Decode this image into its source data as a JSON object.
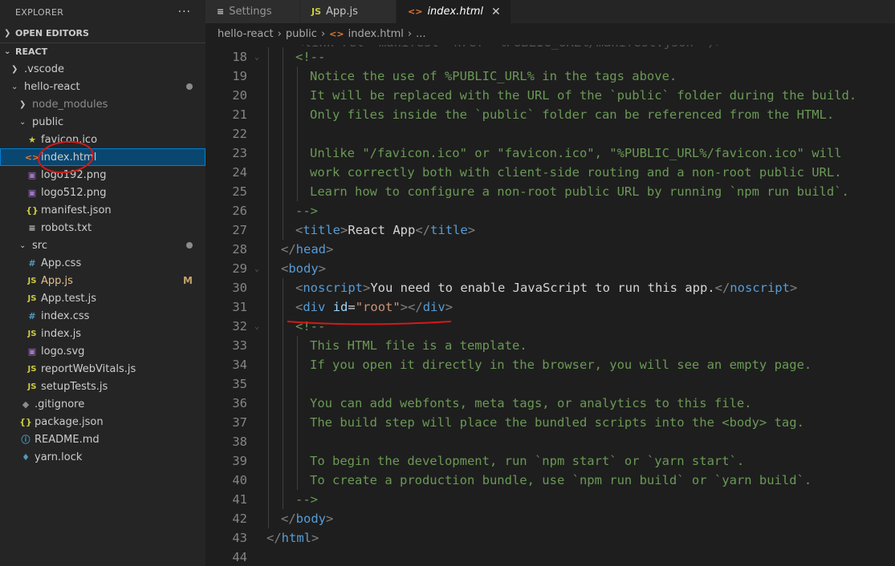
{
  "sidebar": {
    "title": "EXPLORER",
    "more": "···",
    "open_editors": "OPEN EDITORS",
    "workspace": "REACT",
    "tree": [
      {
        "label": ".vscode",
        "indent": 1,
        "kind": "folder-closed"
      },
      {
        "label": "hello-react",
        "indent": 1,
        "kind": "folder-open",
        "badge": "dot"
      },
      {
        "label": "node_modules",
        "indent": 2,
        "kind": "folder-closed",
        "dim": true
      },
      {
        "label": "public",
        "indent": 2,
        "kind": "folder-open"
      },
      {
        "label": "favicon.ico",
        "indent": 3,
        "icon": "star-icon",
        "glyph": "★",
        "cls": "ic-star"
      },
      {
        "label": "index.html",
        "indent": 3,
        "icon": "html-icon",
        "glyph": "<>",
        "cls": "ic-html",
        "selected": true
      },
      {
        "label": "logo192.png",
        "indent": 3,
        "icon": "image-icon",
        "glyph": "▣",
        "cls": "ic-img"
      },
      {
        "label": "logo512.png",
        "indent": 3,
        "icon": "image-icon",
        "glyph": "▣",
        "cls": "ic-img"
      },
      {
        "label": "manifest.json",
        "indent": 3,
        "icon": "json-icon",
        "glyph": "{}",
        "cls": "ic-json"
      },
      {
        "label": "robots.txt",
        "indent": 3,
        "icon": "text-file-icon",
        "glyph": "≡",
        "cls": "ic-txt"
      },
      {
        "label": "src",
        "indent": 2,
        "kind": "folder-open",
        "badge": "dot"
      },
      {
        "label": "App.css",
        "indent": 3,
        "icon": "css-icon",
        "glyph": "#",
        "cls": "ic-css"
      },
      {
        "label": "App.js",
        "indent": 3,
        "icon": "js-icon",
        "glyph": "JS",
        "cls": "ic-js",
        "badge": "M",
        "yellow": true
      },
      {
        "label": "App.test.js",
        "indent": 3,
        "icon": "test-js-icon",
        "glyph": "JS",
        "cls": "ic-js"
      },
      {
        "label": "index.css",
        "indent": 3,
        "icon": "css-icon",
        "glyph": "#",
        "cls": "ic-css"
      },
      {
        "label": "index.js",
        "indent": 3,
        "icon": "js-icon",
        "glyph": "JS",
        "cls": "ic-js"
      },
      {
        "label": "logo.svg",
        "indent": 3,
        "icon": "svg-icon",
        "glyph": "▣",
        "cls": "ic-img"
      },
      {
        "label": "reportWebVitals.js",
        "indent": 3,
        "icon": "js-icon",
        "glyph": "JS",
        "cls": "ic-js"
      },
      {
        "label": "setupTests.js",
        "indent": 3,
        "icon": "js-icon",
        "glyph": "JS",
        "cls": "ic-js"
      },
      {
        "label": ".gitignore",
        "indent": 2,
        "icon": "git-icon",
        "glyph": "◆",
        "cls": "ic-git"
      },
      {
        "label": "package.json",
        "indent": 2,
        "icon": "json-icon",
        "glyph": "{}",
        "cls": "ic-json"
      },
      {
        "label": "README.md",
        "indent": 2,
        "icon": "info-icon",
        "glyph": "ⓘ",
        "cls": "ic-info"
      },
      {
        "label": "yarn.lock",
        "indent": 2,
        "icon": "yarn-icon",
        "glyph": "♦",
        "cls": "ic-yarn"
      }
    ]
  },
  "tabs": [
    {
      "label": "Settings",
      "icon": "≡",
      "active": false
    },
    {
      "label": "App.js",
      "icon": "JS",
      "active": false
    },
    {
      "label": "index.html",
      "icon": "<>",
      "active": true,
      "close": "✕"
    }
  ],
  "breadcrumb": [
    "hello-react",
    "public",
    "index.html",
    "..."
  ],
  "editor": {
    "partial_top": "    <link rel=\"manifest\" href=\"%PUBLIC_URL%/manifest.json\" />",
    "lines": [
      {
        "n": "18",
        "fold": "⌄",
        "indent": 2,
        "tokens": [
          [
            "c-com",
            "<!--"
          ]
        ]
      },
      {
        "n": "19",
        "indent": 3,
        "tokens": [
          [
            "c-com",
            "Notice the use of %PUBLIC_URL% in the tags above."
          ]
        ]
      },
      {
        "n": "20",
        "indent": 3,
        "tokens": [
          [
            "c-com",
            "It will be replaced with the URL of the `public` folder during the build."
          ]
        ]
      },
      {
        "n": "21",
        "indent": 3,
        "tokens": [
          [
            "c-com",
            "Only files inside the `public` folder can be referenced from the HTML."
          ]
        ]
      },
      {
        "n": "22",
        "indent": 3,
        "tokens": []
      },
      {
        "n": "23",
        "indent": 3,
        "tokens": [
          [
            "c-com",
            "Unlike \"/favicon.ico\" or \"favicon.ico\", \"%PUBLIC_URL%/favicon.ico\" will"
          ]
        ]
      },
      {
        "n": "24",
        "indent": 3,
        "tokens": [
          [
            "c-com",
            "work correctly both with client-side routing and a non-root public URL."
          ]
        ]
      },
      {
        "n": "25",
        "indent": 3,
        "tokens": [
          [
            "c-com",
            "Learn how to configure a non-root public URL by running `npm run build`."
          ]
        ]
      },
      {
        "n": "26",
        "indent": 2,
        "tokens": [
          [
            "c-com",
            "-->"
          ]
        ]
      },
      {
        "n": "27",
        "indent": 2,
        "tokens": [
          [
            "c-br",
            "<"
          ],
          [
            "c-tag",
            "title"
          ],
          [
            "c-br",
            ">"
          ],
          [
            "c-text",
            "React App"
          ],
          [
            "c-br",
            "</"
          ],
          [
            "c-tag",
            "title"
          ],
          [
            "c-br",
            ">"
          ]
        ]
      },
      {
        "n": "28",
        "indent": 1,
        "tokens": [
          [
            "c-br",
            "</"
          ],
          [
            "c-tag",
            "head"
          ],
          [
            "c-br",
            ">"
          ]
        ]
      },
      {
        "n": "29",
        "fold": "⌄",
        "indent": 1,
        "tokens": [
          [
            "c-br",
            "<"
          ],
          [
            "c-tag",
            "body"
          ],
          [
            "c-br",
            ">"
          ]
        ]
      },
      {
        "n": "30",
        "indent": 2,
        "tokens": [
          [
            "c-br",
            "<"
          ],
          [
            "c-tag",
            "noscript"
          ],
          [
            "c-br",
            ">"
          ],
          [
            "c-text",
            "You need to enable JavaScript to run this app."
          ],
          [
            "c-br",
            "</"
          ],
          [
            "c-tag",
            "noscript"
          ],
          [
            "c-br",
            ">"
          ]
        ]
      },
      {
        "n": "31",
        "indent": 2,
        "tokens": [
          [
            "c-br",
            "<"
          ],
          [
            "c-tag",
            "div"
          ],
          [
            "c-text",
            " "
          ],
          [
            "c-attr",
            "id"
          ],
          [
            "c-text",
            "="
          ],
          [
            "c-str",
            "\"root\""
          ],
          [
            "c-br",
            "></"
          ],
          [
            "c-tag",
            "div"
          ],
          [
            "c-br",
            ">"
          ]
        ]
      },
      {
        "n": "32",
        "fold": "⌄",
        "indent": 2,
        "tokens": [
          [
            "c-com",
            "<!--"
          ]
        ]
      },
      {
        "n": "33",
        "indent": 3,
        "tokens": [
          [
            "c-com",
            "This HTML file is a template."
          ]
        ]
      },
      {
        "n": "34",
        "indent": 3,
        "tokens": [
          [
            "c-com",
            "If you open it directly in the browser, you will see an empty page."
          ]
        ]
      },
      {
        "n": "35",
        "indent": 3,
        "tokens": []
      },
      {
        "n": "36",
        "indent": 3,
        "tokens": [
          [
            "c-com",
            "You can add webfonts, meta tags, or analytics to this file."
          ]
        ]
      },
      {
        "n": "37",
        "indent": 3,
        "tokens": [
          [
            "c-com",
            "The build step will place the bundled scripts into the <body> tag."
          ]
        ]
      },
      {
        "n": "38",
        "indent": 3,
        "tokens": []
      },
      {
        "n": "39",
        "indent": 3,
        "tokens": [
          [
            "c-com",
            "To begin the development, run `npm start` or `yarn start`."
          ]
        ]
      },
      {
        "n": "40",
        "indent": 3,
        "tokens": [
          [
            "c-com",
            "To create a production bundle, use `npm run build` or `yarn build`."
          ]
        ]
      },
      {
        "n": "41",
        "indent": 2,
        "tokens": [
          [
            "c-com",
            "-->"
          ]
        ]
      },
      {
        "n": "42",
        "indent": 1,
        "tokens": [
          [
            "c-br",
            "</"
          ],
          [
            "c-tag",
            "body"
          ],
          [
            "c-br",
            ">"
          ]
        ]
      },
      {
        "n": "43",
        "indent": 0,
        "tokens": [
          [
            "c-br",
            "</"
          ],
          [
            "c-tag",
            "html"
          ],
          [
            "c-br",
            ">"
          ]
        ]
      },
      {
        "n": "44",
        "indent": 0,
        "tokens": []
      }
    ]
  },
  "colors": {
    "annotation": "#d21a1a",
    "selection": "#094771"
  }
}
